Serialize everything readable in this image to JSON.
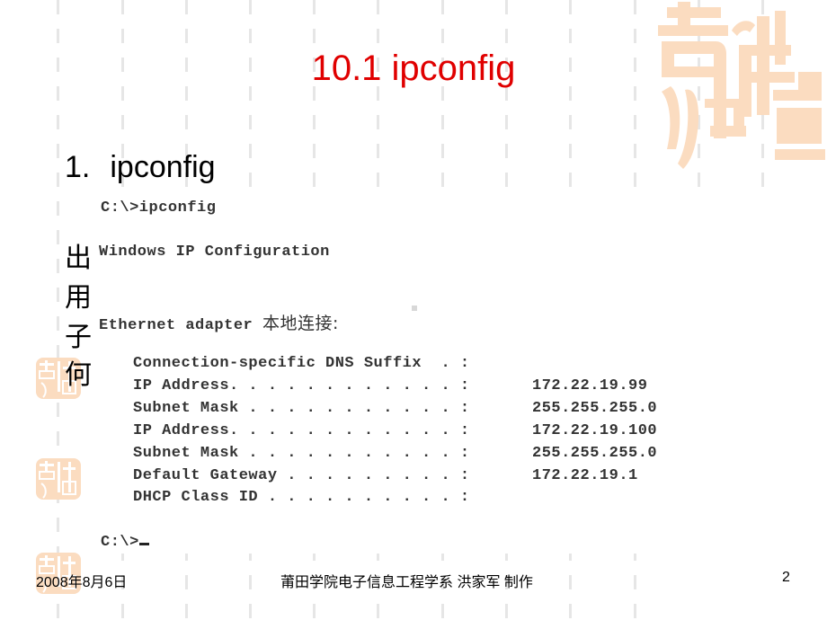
{
  "slide": {
    "title": "10.1 ipconfig",
    "bullet": {
      "number": "1.",
      "text": "ipconfig"
    },
    "obscured_body_chars": [
      "出",
      "用",
      "子",
      "何"
    ],
    "watermark_seal_text": "吉祥如意",
    "colors": {
      "title": "#e00000",
      "seal": "#fbdcc0",
      "dashed_lines": "#e6e6e6"
    }
  },
  "command_prompt": {
    "command": "C:\\>ipconfig",
    "header": "Windows IP Configuration",
    "adapter_prefix": "Ethernet adapter ",
    "adapter_name": "本地连接:",
    "entries": [
      {
        "label": "Connection-specific DNS Suffix  . :",
        "value": ""
      },
      {
        "label": "IP Address. . . . . . . . . . . . :",
        "value": "172.22.19.99"
      },
      {
        "label": "Subnet Mask . . . . . . . . . . . :",
        "value": "255.255.255.0"
      },
      {
        "label": "IP Address. . . . . . . . . . . . :",
        "value": "172.22.19.100"
      },
      {
        "label": "Subnet Mask . . . . . . . . . . . :",
        "value": "255.255.255.0"
      },
      {
        "label": "Default Gateway . . . . . . . . . :",
        "value": "172.22.19.1"
      },
      {
        "label": "DHCP Class ID . . . . . . . . . . :",
        "value": ""
      }
    ],
    "final_prompt": "C:\\>"
  },
  "footer": {
    "date": "2008年8月6日",
    "author": "莆田学院电子信息工程学系 洪家军 制作",
    "page_number": "2"
  }
}
